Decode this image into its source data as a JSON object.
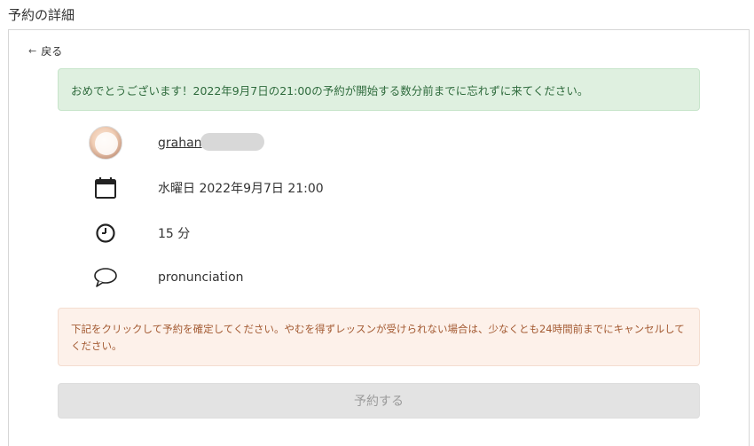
{
  "page": {
    "title": "予約の詳細"
  },
  "back_link": {
    "label": "戻る",
    "icon": "arrow-left-icon"
  },
  "success_alert": {
    "text": "おめでとうございます！2022年9月7日の21:00の予約が開始する数分前までに忘れずに来てください。",
    "color": "#dff0e0"
  },
  "details": {
    "teacher": {
      "name": "grahan",
      "icon": "avatar"
    },
    "datetime": {
      "text": "水曜日 2022年9月7日 21:00",
      "icon": "calendar-icon"
    },
    "duration": {
      "text": "15 分",
      "icon": "clock-icon"
    },
    "topic": {
      "text": "pronunciation",
      "icon": "speech-bubble-icon"
    }
  },
  "warning_alert": {
    "text": "下記をクリックして予約を確定してください。やむを得ずレッスンが受けられない場合は、少なくとも24時間前までにキャンセルしてください。",
    "color": "#fdf1ea"
  },
  "confirm_button": {
    "label": "予約する",
    "state": "disabled"
  }
}
